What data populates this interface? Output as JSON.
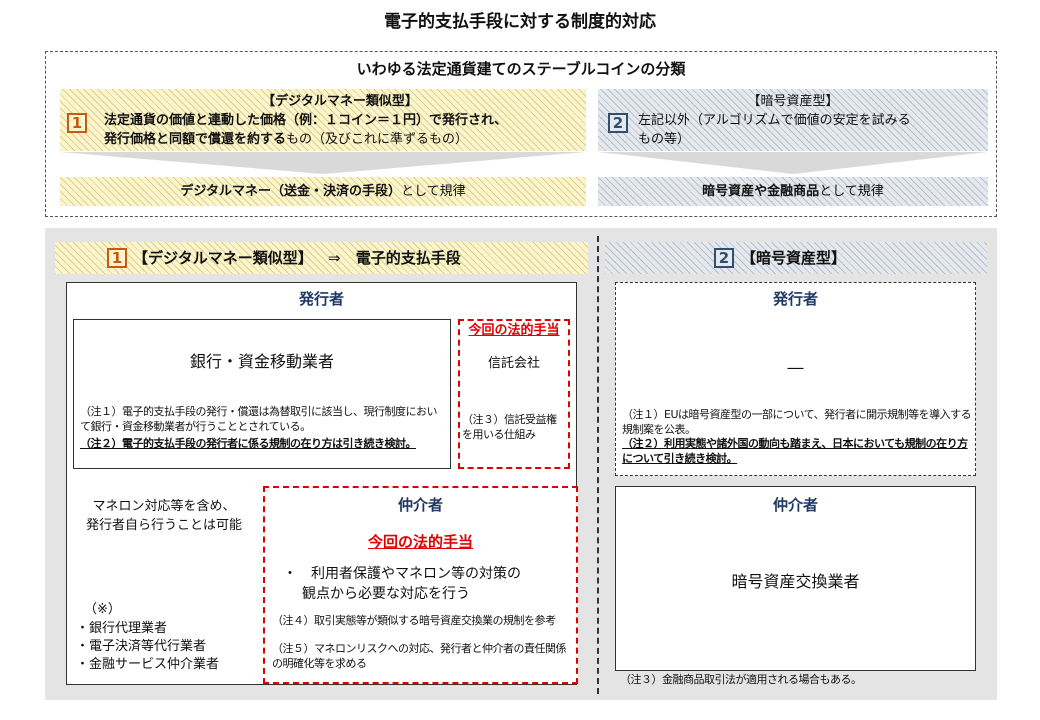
{
  "title": "電子的支払手段に対する制度的対応",
  "classification": {
    "heading": "いわゆる法定通貨建てのステーブルコインの分類",
    "type1": {
      "number": "1",
      "label": "【デジタルマネー類似型】",
      "desc_bold_1": "法定通貨の価値と連動した価格（例：１コイン＝１円）で発行され、",
      "desc_bold_2": "発行価格と同額で償還を約する",
      "desc_rest": "もの（及びこれに準ずるもの）",
      "regulate_bold": "デジタルマネー（送金・決済の手段）",
      "regulate_rest": "として規律"
    },
    "type2": {
      "number": "2",
      "label": "【暗号資産型】",
      "desc_1": "左記以外（アルゴリズムで価値の安定を試みる",
      "desc_2": "もの等）",
      "regulate_bold": "暗号資産や金融商品",
      "regulate_rest": "として規律"
    }
  },
  "left_panel": {
    "number": "1",
    "header_label": "【デジタルマネー類似型】",
    "header_arrow": "⇒",
    "header_target": "電子的支払手段",
    "issuer_title": "発行者",
    "issuer_entity": "銀行・資金移動業者",
    "note1": "（注１）電子的支払手段の発行・償還は為替取引に該当し、現行制度において銀行・資金移動業者が行うこととされている。",
    "note2": "（注２）電子的支払手段の発行者に係る規制の在り方は引き続き検討。",
    "new_measure_label": "今回の法的手当",
    "trust_company": "信託会社",
    "note3": "（注３）信託受益権を用いる仕組み",
    "issuer_self_1": "マネロン対応等を含め、",
    "issuer_self_2": "発行者自ら行うことは可能",
    "intermediary_title": "仲介者",
    "intermediary_measure": "今回の法的手当",
    "intermediary_bullet_1": "・　利用者保護やマネロン等の対策の",
    "intermediary_bullet_2": "観点から必要な対応を行う",
    "note4": "（注４）取引実態等が類似する暗号資産交換業の規制を参考",
    "note5": "（注５）マネロンリスクへの対応、発行者と仲介者の責任関係の明確化等を求める",
    "ref_mark": "（※）",
    "ref_items": [
      "・銀行代理業者",
      "・電子決済等代行業者",
      "・金融サービス仲介業者"
    ]
  },
  "right_panel": {
    "number": "2",
    "header_label": "【暗号資産型】",
    "issuer_title": "発行者",
    "issuer_entity": "―",
    "note1": "（注１）EUは暗号資産型の一部について、発行者に開示規制等を導入する規制案を公表。",
    "note2": "（注２）利用実態や諸外国の動向も踏まえ、日本においても規制の在り方について引き続き検討。",
    "intermediary_title": "仲介者",
    "intermediary_entity": "暗号資産交換業者",
    "note3": "（注３）金融商品取引法が適用される場合もある。"
  },
  "colors": {
    "navy": "#1f3864",
    "red": "#e00000",
    "num_box_1": "#c55a11",
    "num_box_2": "#2f4f6f",
    "panel_gray": "#e4e4e4"
  }
}
